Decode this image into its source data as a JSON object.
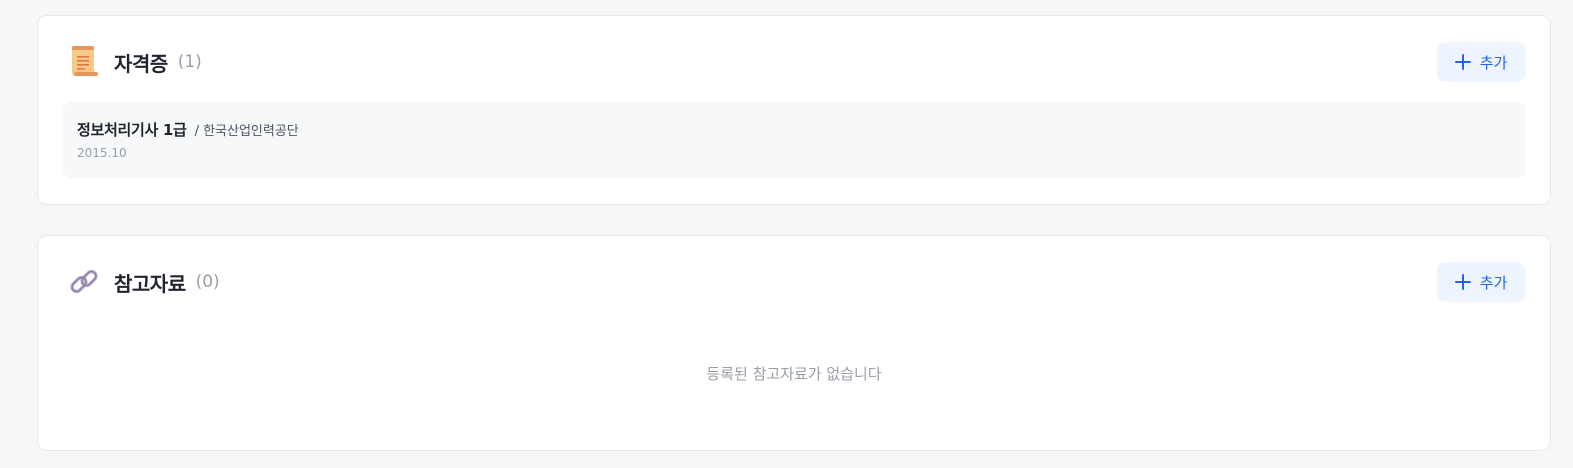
{
  "certificates": {
    "title": "자격증",
    "count": "(1)",
    "add_label": "추가",
    "icon": "scroll-icon",
    "items": [
      {
        "name": "정보처리기사 1급",
        "issuer": "/ 한국산업인력공단",
        "date": "2015.10"
      }
    ]
  },
  "references": {
    "title": "참고자료",
    "count": "(0)",
    "add_label": "추가",
    "icon": "link-icon",
    "empty_message": "등록된 참고자료가 없습니다"
  },
  "colors": {
    "accent": "#2563eb",
    "add_button_bg": "#eef4fd",
    "muted_text": "#9aa0a8",
    "page_bg": "#f7f7f8"
  }
}
